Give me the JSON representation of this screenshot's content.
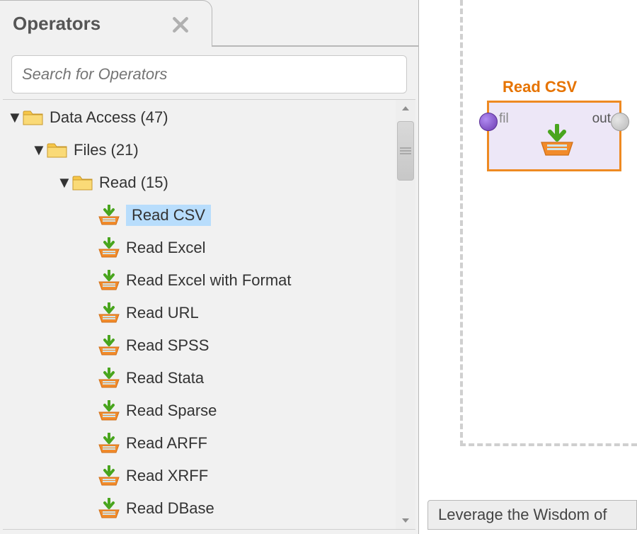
{
  "panel": {
    "title": "Operators",
    "search_placeholder": "Search for Operators"
  },
  "tree": {
    "root": {
      "label": "Data Access (47)"
    },
    "files": {
      "label": "Files (21)"
    },
    "read": {
      "label": "Read (15)"
    },
    "items": [
      {
        "label": "Read CSV",
        "selected": true
      },
      {
        "label": "Read Excel"
      },
      {
        "label": "Read Excel with Format"
      },
      {
        "label": "Read URL"
      },
      {
        "label": "Read SPSS"
      },
      {
        "label": "Read Stata"
      },
      {
        "label": "Read Sparse"
      },
      {
        "label": "Read ARFF"
      },
      {
        "label": "Read XRFF"
      },
      {
        "label": "Read DBase"
      }
    ]
  },
  "canvas": {
    "node": {
      "title": "Read CSV",
      "port_in_label": "fil",
      "port_out_label": "out"
    }
  },
  "help": {
    "text": "Leverage the Wisdom of"
  }
}
